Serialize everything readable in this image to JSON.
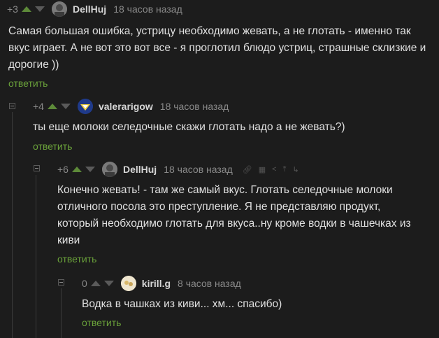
{
  "comments": [
    {
      "rating": "+3",
      "user": "DellHuj",
      "time": "18 часов назад",
      "text": "Самая большая ошибка, устрицу необходимо жевать, а не глотать - именно так вкус играет. А не вот это вот все - я проглотил блюдо устриц, страшные склизкие и дорогие ))",
      "reply": "ответить"
    },
    {
      "rating": "+4",
      "user": "valerarigow",
      "time": "18 часов назад",
      "text": "ты еще молоки селедочные скажи глотать надо а не жевать?)",
      "reply": "ответить"
    },
    {
      "rating": "+6",
      "user": "DellHuj",
      "time": "18 часов назад",
      "text": "Конечно жевать! - там же самый вкус. Глотать селедочные молоки отличного посола это преступление. Я не представляю продукт, который необходимо глотать для вкуса..ну кроме водки в чашечках из киви",
      "reply": "ответить",
      "tools": [
        "link-icon",
        "save-icon",
        "share-icon",
        "scroll-up-icon",
        "branch-icon"
      ]
    },
    {
      "rating": "0",
      "user": "kirill.g",
      "time": "8 часов назад",
      "text": "Водка в чашках из киви... хм... спасибо)",
      "reply": "ответить"
    }
  ],
  "colors": {
    "accent": "#6aa13a",
    "upvote": "#5d8a39",
    "background": "#1c1c1c"
  }
}
